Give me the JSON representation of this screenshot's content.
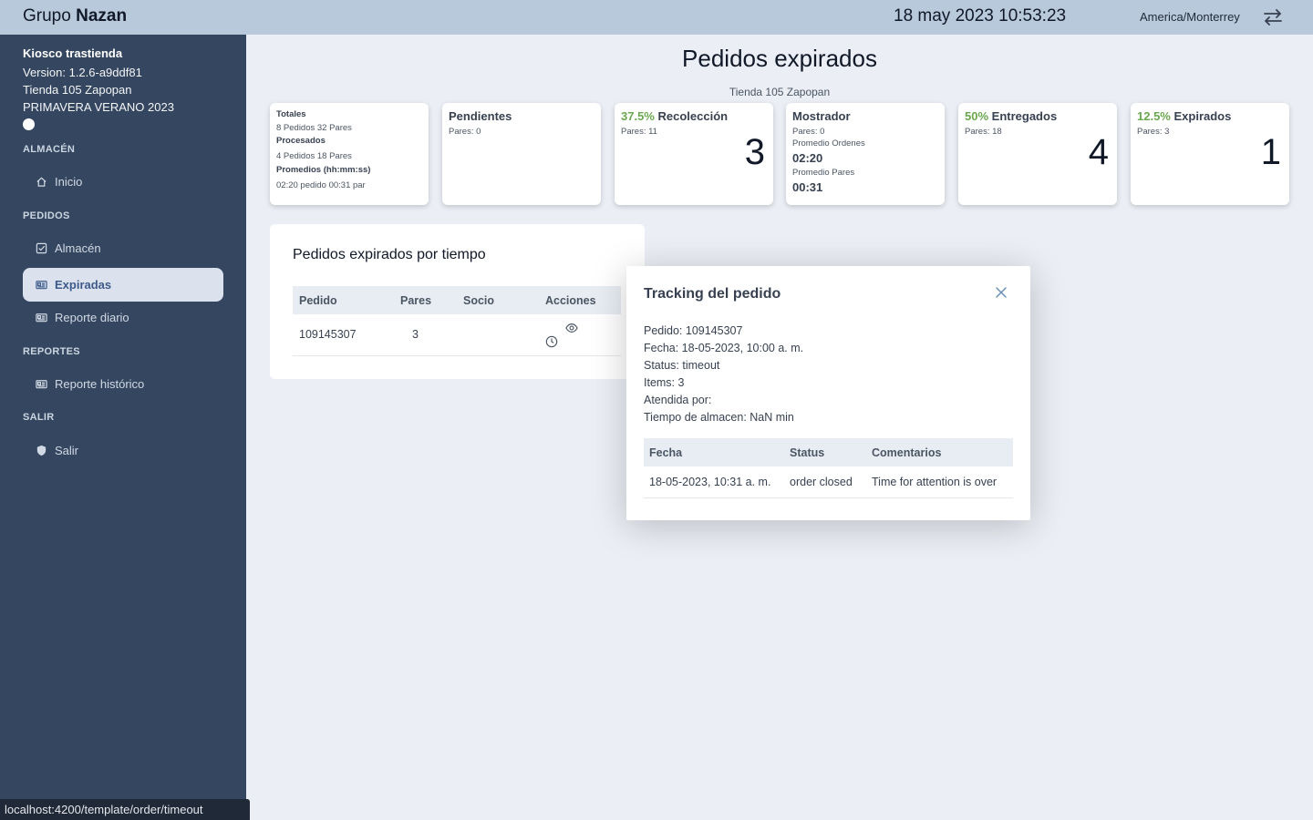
{
  "header": {
    "brand_light": "Grupo",
    "brand_bold": "Nazan",
    "datetime": "18 may 2023 10:53:23",
    "timezone": "America/Monterrey",
    "swap_icon": "swap-arrows-icon"
  },
  "sidebar": {
    "kiosk_title": "Kiosco trastienda",
    "version": "Version: 1.2.6-a9ddf81",
    "store": "Tienda 105 Zapopan",
    "season": "PRIMAVERA VERANO 2023",
    "sections": [
      {
        "label": "ALMACÉN",
        "items": [
          {
            "label": "Inicio",
            "icon": "home-icon"
          }
        ]
      },
      {
        "label": "PEDIDOS",
        "items": [
          {
            "label": "Almacén",
            "icon": "checkbox-icon"
          },
          {
            "label": "Expiradas",
            "icon": "id-card-icon",
            "active": true
          },
          {
            "label": "Reporte diario",
            "icon": "id-card-icon"
          }
        ]
      },
      {
        "label": "REPORTES",
        "items": [
          {
            "label": "Reporte histórico",
            "icon": "id-card-icon"
          }
        ]
      },
      {
        "label": "SALIR",
        "items": [
          {
            "label": "Salir",
            "icon": "shield-icon"
          }
        ]
      }
    ]
  },
  "main": {
    "title": "Pedidos expirados",
    "store_subtitle": "Tienda 105 Zapopan",
    "cards": {
      "totales": {
        "title": "Totales",
        "line1": "8 Pedidos 32 Pares",
        "procesados_label": "Procesados",
        "line2": "4 Pedidos 18 Pares",
        "promedios_label": "Promedios (hh:mm:ss)",
        "line3": "02:20 pedido 00:31 par"
      },
      "pendientes": {
        "title": "Pendientes",
        "pares": "Pares: 0"
      },
      "recoleccion": {
        "pct": "37.5%",
        "title": "Recolección",
        "pares": "Pares: 11",
        "count": "3"
      },
      "mostrador": {
        "title": "Mostrador",
        "pares": "Pares: 0",
        "prom_ordenes_label": "Promedio Ordenes",
        "prom_ordenes": "02:20",
        "prom_pares_label": "Promedio Pares",
        "prom_pares": "00:31"
      },
      "entregados": {
        "pct": "50%",
        "title": "Entregados",
        "pares": "Pares: 18",
        "count": "4"
      },
      "expirados": {
        "pct": "12.5%",
        "title": "Expirados",
        "pares": "Pares: 3",
        "count": "1"
      }
    },
    "panel": {
      "title": "Pedidos expirados por tiempo",
      "columns": [
        "Pedido",
        "Pares",
        "Socio",
        "Acciones"
      ],
      "rows": [
        {
          "pedido": "109145307",
          "pares": "3",
          "socio": ""
        }
      ],
      "row_action_icons": [
        "eye-icon",
        "clock-icon"
      ]
    }
  },
  "modal": {
    "title": "Tracking del pedido",
    "pedido": "Pedido: 109145307",
    "fecha": "Fecha: 18-05-2023, 10:00 a. m.",
    "status": "Status: timeout",
    "items": "Items: 3",
    "atendida": "Atendida por:",
    "tiempo": "Tiempo de almacen: NaN min",
    "columns": [
      "Fecha",
      "Status",
      "Comentarios"
    ],
    "rows": [
      {
        "fecha": "18-05-2023, 10:31 a. m.",
        "status": "order closed",
        "comentarios": "Time for attention is over"
      }
    ]
  },
  "statusbar": {
    "url": "localhost:4200/template/order/timeout"
  },
  "colors": {
    "accent_green": "#6aa84f",
    "sidebar_bg": "#354760",
    "topbar_bg": "#b8c9dc",
    "active_bg": "#dbe2ee"
  }
}
